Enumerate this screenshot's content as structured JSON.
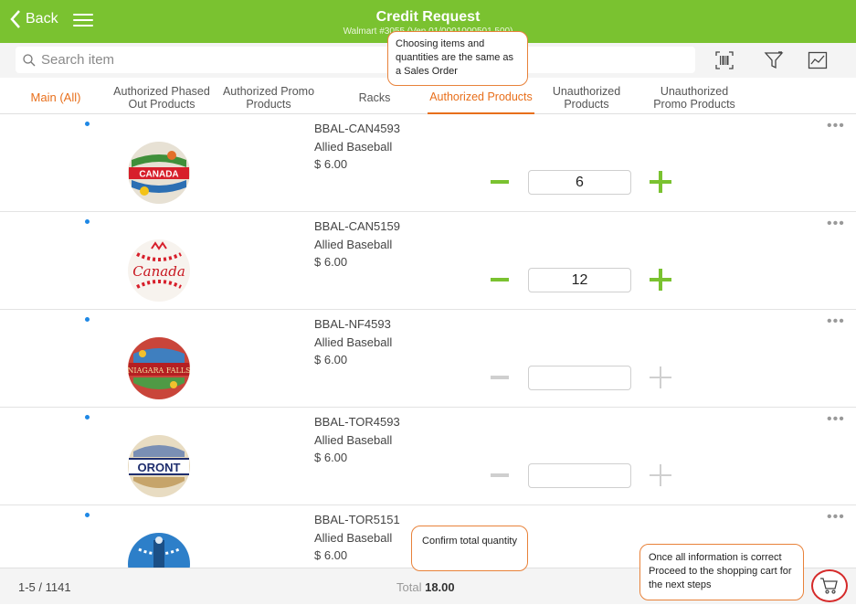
{
  "header": {
    "back_label": "Back",
    "title": "Credit Request",
    "subtitle": "Walmart #3055 (Ven              01/0001000501 500)"
  },
  "search": {
    "placeholder": "Search item"
  },
  "toolbar_icons": [
    "barcode-scan-icon",
    "filter-icon",
    "chart-icon"
  ],
  "tabs": [
    {
      "label": "Main (All)",
      "state": "main"
    },
    {
      "label": "Authorized Phased Out Products",
      "state": "normal"
    },
    {
      "label": "Authorized Promo Products",
      "state": "normal"
    },
    {
      "label": "Racks",
      "state": "normal"
    },
    {
      "label": "Authorized Products",
      "state": "active"
    },
    {
      "label": "Unauthorized Products",
      "state": "normal"
    },
    {
      "label": "Unauthorized Promo Products",
      "state": "normal"
    }
  ],
  "products": [
    {
      "sku": "BBAL-CAN4593",
      "description": "Allied Baseball",
      "price": "$ 6.00",
      "quantity": "6",
      "image": "canada-baseball-image"
    },
    {
      "sku": "BBAL-CAN5159",
      "description": "Allied Baseball",
      "price": "$ 6.00",
      "quantity": "12",
      "image": "canada-script-baseball-image"
    },
    {
      "sku": "BBAL-NF4593",
      "description": "Allied Baseball",
      "price": "$ 6.00",
      "quantity": "",
      "image": "niagara-falls-baseball-image"
    },
    {
      "sku": "BBAL-TOR4593",
      "description": "Allied Baseball",
      "price": "$ 6.00",
      "quantity": "",
      "image": "toronto-baseball-image"
    },
    {
      "sku": "BBAL-TOR5151",
      "description": "Allied Baseball",
      "price": "$ 6.00",
      "quantity": "",
      "image": "toronto-blue-baseball-image"
    }
  ],
  "footer": {
    "pager": "1-5 / 1141",
    "total_label": "Total",
    "total_value": "18.00"
  },
  "callouts": {
    "items_note": "Choosing items and quantities are the same as a Sales Order",
    "total_note": "Confirm total quantity",
    "cart_note": "Once all information is correct Proceed to the shopping cart for the next steps"
  },
  "colors": {
    "brand_green": "#7ac230",
    "active_tab": "#e86f1b",
    "dot_blue": "#1e88e5",
    "callout_border": "#e8823a",
    "cart_ring": "#d52a2a"
  }
}
